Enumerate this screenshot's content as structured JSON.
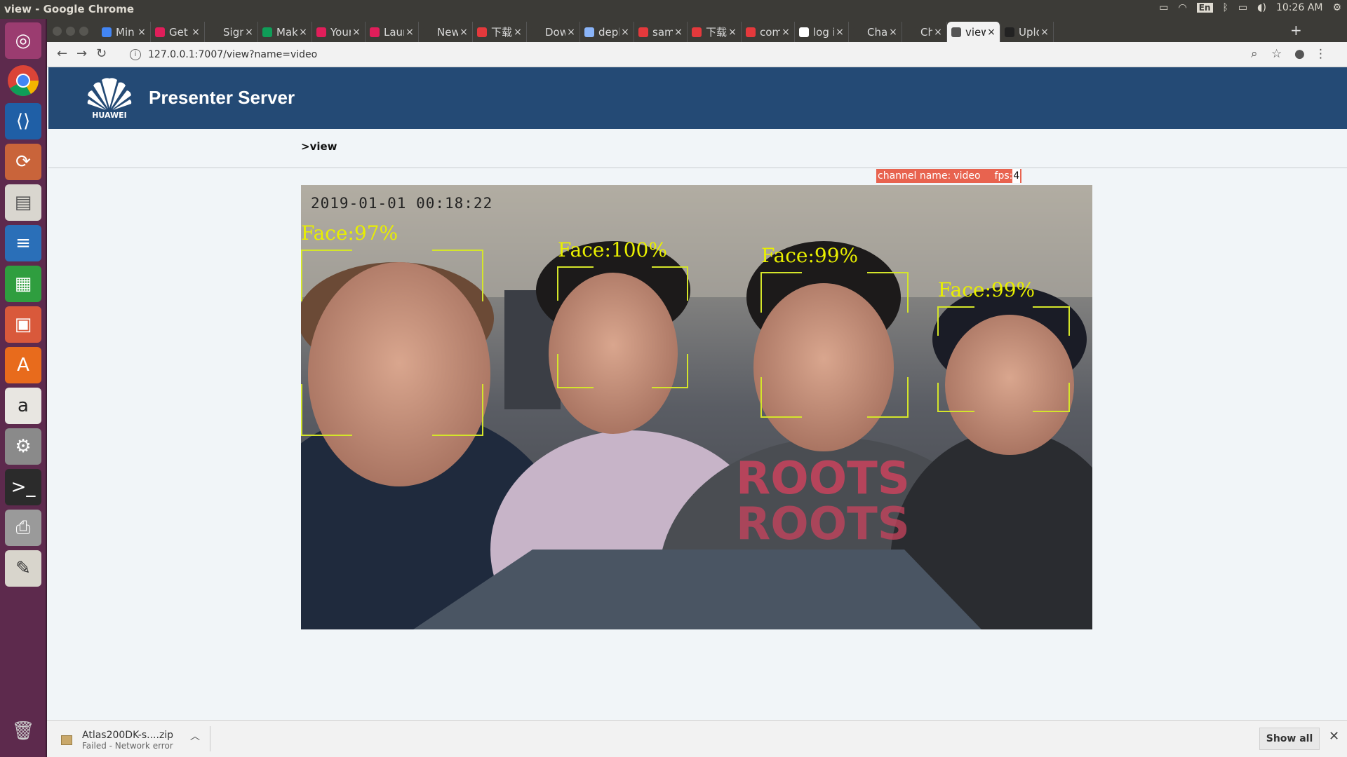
{
  "os": {
    "window_title": "view - Google Chrome",
    "lang": "En",
    "clock": "10:26 AM"
  },
  "tabs": [
    {
      "label": "Min",
      "fav": "#4285f4"
    },
    {
      "label": "Get",
      "fav": "#e01e5a"
    },
    {
      "label": "Sign",
      "fav": "#3c3b37"
    },
    {
      "label": "Mak",
      "fav": "#0f9d58"
    },
    {
      "label": "Your",
      "fav": "#e01e5a"
    },
    {
      "label": "Laur",
      "fav": "#e01e5a"
    },
    {
      "label": "New Tal",
      "fav": "#3c3b37"
    },
    {
      "label": "下载",
      "fav": "#e4393c"
    },
    {
      "label": "Dow",
      "fav": "#3c3b37"
    },
    {
      "label": "depl",
      "fav": "#8ab4f8"
    },
    {
      "label": "sam",
      "fav": "#e4393c"
    },
    {
      "label": "下载",
      "fav": "#e4393c"
    },
    {
      "label": "com",
      "fav": "#e4393c"
    },
    {
      "label": "log i",
      "fav": "#ffffff"
    },
    {
      "label": "Cha",
      "fav": "#3c3b37"
    },
    {
      "label": "Cha",
      "fav": "#3c3b37"
    },
    {
      "label": "view",
      "fav": "#555555"
    },
    {
      "label": "Uplo",
      "fav": "#222222"
    }
  ],
  "tab_close": "×",
  "newtab": "+",
  "address": {
    "url": "127.0.0.1:7007/view?name=video"
  },
  "page": {
    "brand": "Presenter Server",
    "logo_text": "HUAWEI",
    "breadcrumb": ">view",
    "channel_label": "channel name:",
    "channel_value": "video",
    "fps_label": "fps:",
    "fps_value": "4",
    "timestamp": "2019-01-01  00:18:22"
  },
  "faces": [
    {
      "label": "Face:97%"
    },
    {
      "label": "Face:100%"
    },
    {
      "label": "Face:99%"
    },
    {
      "label": "Face:99%"
    }
  ],
  "downloads": {
    "filename": "Atlas200DK-s....zip",
    "status": "Failed - Network error",
    "show_all": "Show all"
  },
  "colors": {
    "header": "#244a75",
    "accent": "#e8634f",
    "face_box": "#d4e52a"
  }
}
